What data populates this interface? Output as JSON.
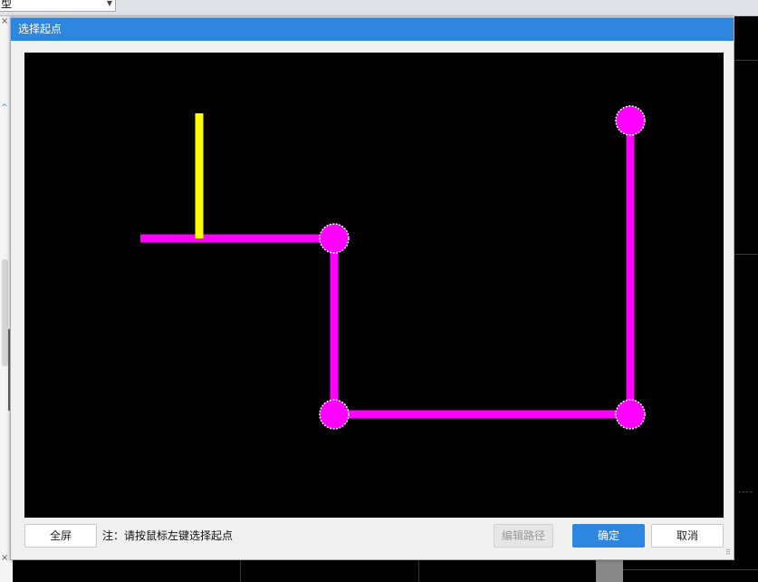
{
  "background": {
    "combo_value": "型",
    "combo_arrow_icon": "chevron-down-icon",
    "left_close_glyph": "×",
    "left_collapse_glyph": "^",
    "left_close_glyph_2": "×",
    "dashes": "- - - -"
  },
  "dialog": {
    "title": "选择起点",
    "hint": "注：请按鼠标左键选择起点",
    "buttons": {
      "fullscreen": "全屏",
      "edit_path": "编辑路径",
      "confirm": "确定",
      "cancel": "取消"
    },
    "resize_grip_icon": "resize-grip-icon"
  },
  "colors": {
    "title_bar": "#2e86de",
    "canvas_background": "#000000",
    "path": "#ff00ff",
    "highlight_segment": "#ffff00",
    "primary_button": "#2e86de"
  }
}
